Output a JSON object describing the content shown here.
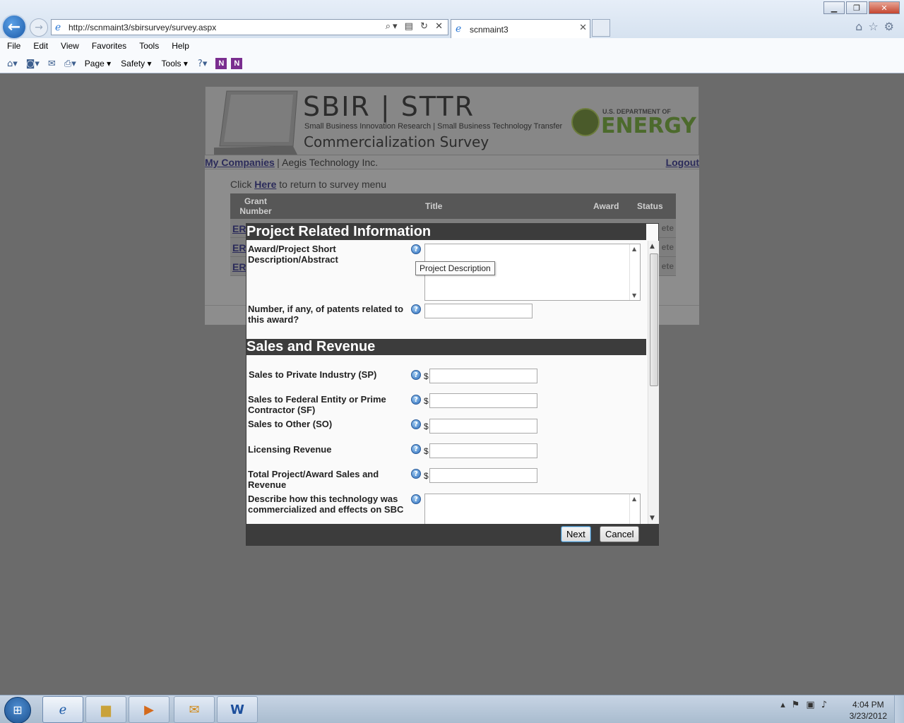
{
  "browser": {
    "url": "http://scnmaint3/sbirsurvey/survey.aspx",
    "tab_title": "scnmaint3",
    "menus": [
      "File",
      "Edit",
      "View",
      "Favorites",
      "Tools",
      "Help"
    ],
    "commands": {
      "page": "Page ▾",
      "safety": "Safety ▾",
      "tools": "Tools ▾"
    }
  },
  "page": {
    "brand": "SBIR | STTR",
    "tagline": "Small Business Innovation Research | Small Business Technology Transfer",
    "survey_title": "Commercialization Survey",
    "doe_small": "U.S. DEPARTMENT OF",
    "doe_big": "ENERGY",
    "user_bar": {
      "my_companies": "My Companies",
      "separator": "|",
      "company": "Aegis Technology Inc.",
      "logout": "Logout"
    },
    "click_prefix": "Click",
    "click_link": "Here",
    "click_suffix": "to return to survey menu",
    "table": {
      "headers": {
        "grant": "Grant Number",
        "title": "Title",
        "award": "Award",
        "status": "Status"
      },
      "rows": [
        {
          "grant": "ER",
          "status": "ete"
        },
        {
          "grant": "ER",
          "status": "ete"
        },
        {
          "grant": "ER",
          "status": "ete"
        }
      ]
    }
  },
  "modal": {
    "section1_title": "Project Related Information",
    "section2_title": "Sales and Revenue",
    "fields": {
      "abstract_label": "Award/Project Short Description/Abstract",
      "patents_label": "Number, if any, of patents related to this award?",
      "sp_label": "Sales to Private Industry (SP)",
      "sf_label": "Sales to Federal Entity or Prime Contractor (SF)",
      "so_label": "Sales to Other (SO)",
      "lic_label": "Licensing Revenue",
      "total_label": "Total Project/Award Sales and Revenue",
      "describe_label": "Describe how this technology was commercialized and effects on SBC"
    },
    "currency": "$",
    "help_glyph": "?",
    "tooltip": "Project Description",
    "next_label": "Next",
    "cancel_label": "Cancel"
  },
  "taskbar": {
    "time": "4:04 PM",
    "date": "3/23/2012"
  },
  "colors": {
    "overlay_gray": "#6b6b6b",
    "section_header": "#3c3c3c",
    "help_icon_blue": "#2f6fbd"
  }
}
